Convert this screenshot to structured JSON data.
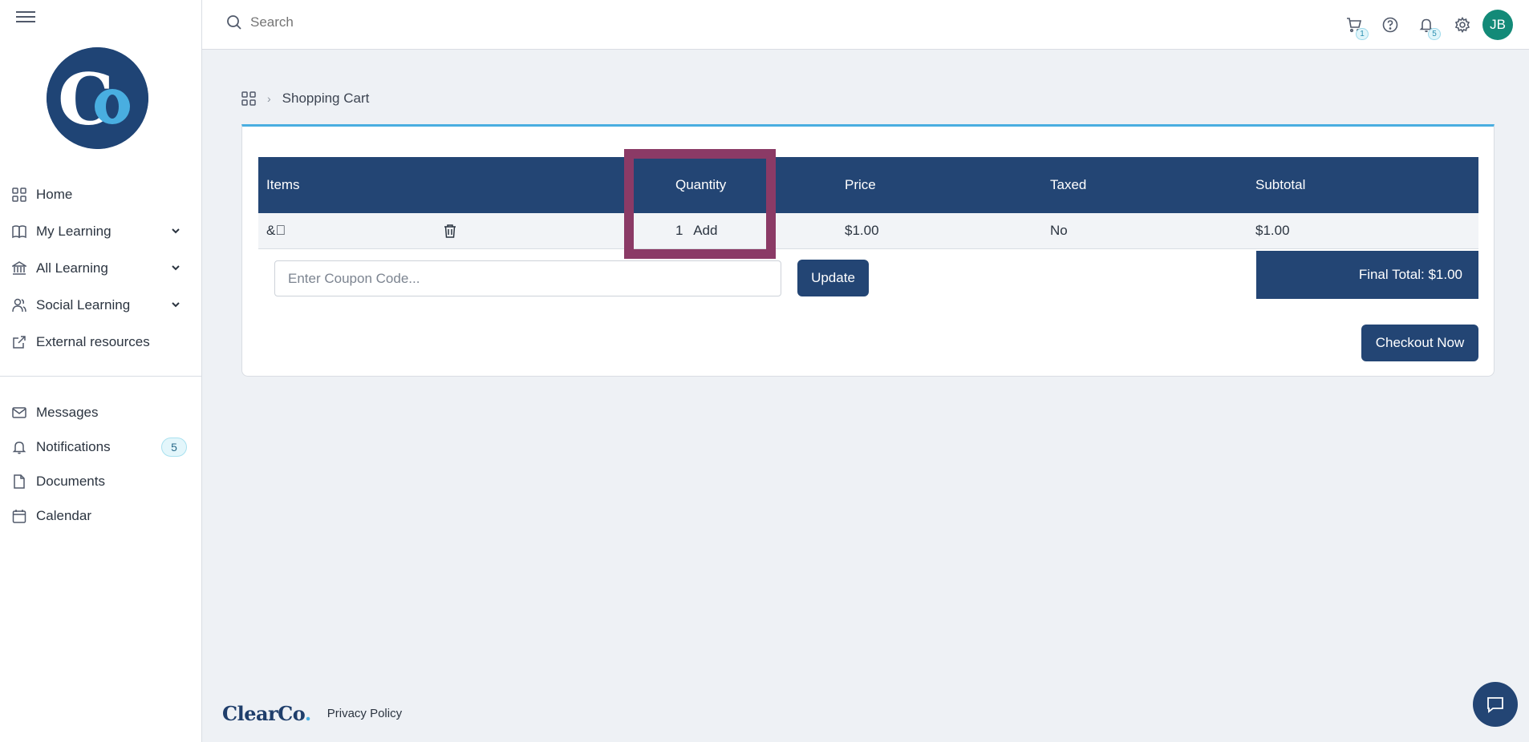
{
  "topbar": {
    "search_placeholder": "Search",
    "cart_count": "1",
    "notification_count": "5",
    "avatar_initials": "JB"
  },
  "sidebar": {
    "items": [
      {
        "label": "Home",
        "icon": "grid-icon",
        "expandable": false
      },
      {
        "label": "My Learning",
        "icon": "book-icon",
        "expandable": true
      },
      {
        "label": "All Learning",
        "icon": "institution-icon",
        "expandable": true
      },
      {
        "label": "Social Learning",
        "icon": "users-icon",
        "expandable": true
      },
      {
        "label": "External resources",
        "icon": "external-link-icon",
        "expandable": false
      }
    ],
    "secondary_items": [
      {
        "label": "Messages",
        "icon": "mail-icon"
      },
      {
        "label": "Notifications",
        "icon": "bell-icon",
        "badge": "5"
      },
      {
        "label": "Documents",
        "icon": "document-icon"
      },
      {
        "label": "Calendar",
        "icon": "calendar-icon"
      }
    ]
  },
  "breadcrumb": {
    "current": "Shopping Cart"
  },
  "cart": {
    "columns": [
      "Items",
      "Quantity",
      "Price",
      "Taxed",
      "Subtotal"
    ],
    "rows": [
      {
        "item": "&\u0000",
        "quantity": "1",
        "add_label": "Add",
        "price": "$1.00",
        "taxed": "No",
        "subtotal": "$1.00"
      }
    ],
    "coupon_placeholder": "Enter Coupon Code...",
    "update_label": "Update",
    "final_total_label": "Final Total:",
    "final_total_value": "$1.00",
    "checkout_label": "Checkout Now"
  },
  "footer": {
    "logo_text": "ClearCo",
    "privacy_label": "Privacy Policy"
  },
  "colors": {
    "primary": "#234574",
    "accent": "#49aee0",
    "highlight": "#8b3a66",
    "avatar": "#138a78"
  }
}
